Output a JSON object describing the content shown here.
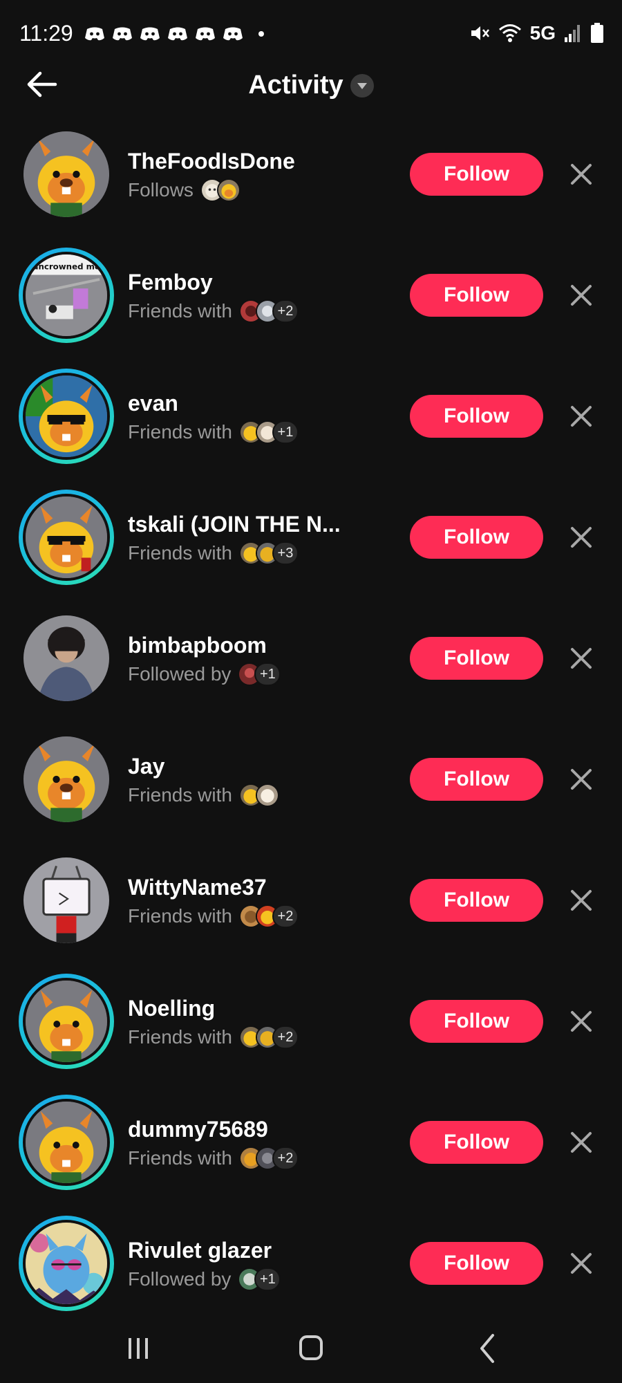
{
  "status_bar": {
    "time": "11:29",
    "notification_icons": [
      "discord-icon",
      "discord-icon",
      "discord-icon",
      "discord-icon",
      "discord-icon",
      "discord-icon"
    ],
    "network": "5G",
    "right_icons": [
      "mute-icon",
      "wifi-icon",
      "signal-icon",
      "battery-icon"
    ]
  },
  "header": {
    "back_icon": "back-arrow-icon",
    "title": "Activity",
    "dropdown_icon": "caret-down-icon"
  },
  "colors": {
    "background": "#111111",
    "follow_button": "#fe2c55",
    "secondary_text": "#9a9a9a",
    "story_ring_start": "#1aa7ec",
    "story_ring_end": "#2de0b0"
  },
  "suggestions": [
    {
      "username": "TheFoodIsDone",
      "relation": "Follows",
      "mutual_extra": "",
      "follow_label": "Follow",
      "has_story_ring": false
    },
    {
      "username": "Femboy",
      "relation": "Friends with",
      "mutual_extra": "+2",
      "follow_label": "Follow",
      "has_story_ring": true
    },
    {
      "username": "evan",
      "relation": "Friends with",
      "mutual_extra": "+1",
      "follow_label": "Follow",
      "has_story_ring": true
    },
    {
      "username": "tskali (JOIN THE N...",
      "relation": "Friends with",
      "mutual_extra": "+3",
      "follow_label": "Follow",
      "has_story_ring": true
    },
    {
      "username": "bimbapboom",
      "relation": "Followed by",
      "mutual_extra": "+1",
      "follow_label": "Follow",
      "has_story_ring": false
    },
    {
      "username": "Jay",
      "relation": "Friends with",
      "mutual_extra": "",
      "follow_label": "Follow",
      "has_story_ring": false
    },
    {
      "username": "WittyName37",
      "relation": "Friends with",
      "mutual_extra": "+2",
      "follow_label": "Follow",
      "has_story_ring": false
    },
    {
      "username": "Noelling",
      "relation": "Friends with",
      "mutual_extra": "+2",
      "follow_label": "Follow",
      "has_story_ring": true
    },
    {
      "username": "dummy75689",
      "relation": "Friends with",
      "mutual_extra": "+2",
      "follow_label": "Follow",
      "has_story_ring": true
    },
    {
      "username": "Rivulet glazer",
      "relation": "Followed by",
      "mutual_extra": "+1",
      "follow_label": "Follow",
      "has_story_ring": true
    }
  ],
  "avatar_images": {
    "femboy_text": "uncrowned me"
  },
  "nav_bar": {
    "recents_icon": "recent-apps-icon",
    "home_icon": "home-icon",
    "back_icon": "back-chevron-icon"
  }
}
